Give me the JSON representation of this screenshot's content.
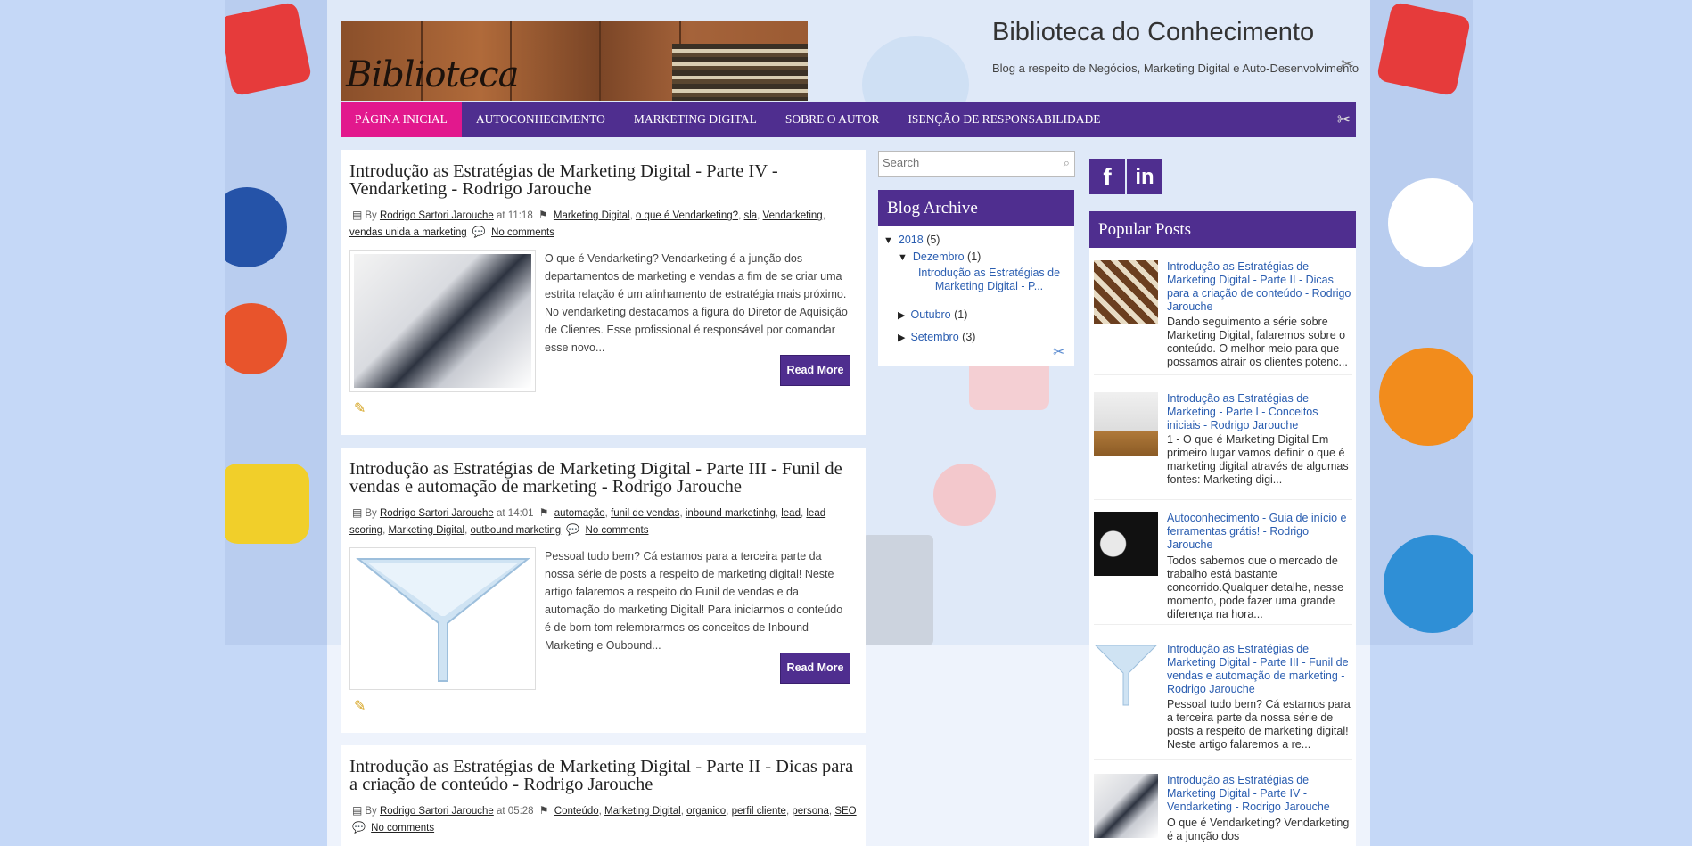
{
  "header": {
    "banner_word": "Biblioteca",
    "title": "Biblioteca do Conhecimento",
    "description": "Blog a respeito de Negócios, Marketing Digital e Auto-Desenvolvimento"
  },
  "nav": {
    "items": [
      {
        "label": "Página Inicial"
      },
      {
        "label": "Autoconhecimento"
      },
      {
        "label": "Marketing Digital"
      },
      {
        "label": "Sobre o Autor"
      },
      {
        "label": "Isenção de Responsabilidade"
      }
    ]
  },
  "posts": [
    {
      "title": "Introdução as Estratégias de Marketing Digital - Parte IV - Vendarketing - Rodrigo Jarouche",
      "by": "By",
      "author": "Rodrigo Sartori Jarouche",
      "at": "at 11:18",
      "labels": [
        "Marketing Digital",
        "o que é Vendarketing?",
        "sla",
        "Vendarketing",
        "vendas unida a marketing"
      ],
      "comments": "No comments",
      "excerpt": "O que é Vendarketing? Vendarketing é a junção dos departamentos de marketing e vendas a fim de se criar uma estrita relação é um alinhamento de estratégia mais próximo. No vendarketing destacamos a figura do Diretor de Aquisição de Clientes. Esse profissional é responsável por comandar esse novo...",
      "read_more": "Read More"
    },
    {
      "title": "Introdução as Estratégias de Marketing Digital - Parte III - Funil de vendas e automação de marketing - Rodrigo Jarouche",
      "by": "By",
      "author": "Rodrigo Sartori Jarouche",
      "at": "at 14:01",
      "labels": [
        "automação",
        "funil de vendas",
        "inbound marketinhg",
        "lead",
        "lead scoring",
        "Marketing Digital",
        "outbound marketing"
      ],
      "comments": "No comments",
      "excerpt": "Pessoal tudo bem? Cá estamos para a terceira parte da nossa série de posts a respeito de marketing digital! Neste artigo falaremos a respeito do Funil de vendas e da automação do marketing Digital! Para iniciarmos o conteúdo é de bom tom relembrarmos os conceitos de Inbound Marketing e Oubound...",
      "read_more": "Read More"
    },
    {
      "title": "Introdução as Estratégias de Marketing Digital - Parte II - Dicas para a criação de conteúdo - Rodrigo Jarouche",
      "by": "By",
      "author": "Rodrigo Sartori Jarouche",
      "at": "at 05:28",
      "labels": [
        "Conteúdo",
        "Marketing Digital",
        "organico",
        "perfil cliente",
        "persona",
        "SEO"
      ],
      "comments": "No comments"
    }
  ],
  "search": {
    "placeholder": "Search"
  },
  "archive": {
    "heading": "Blog Archive",
    "year": "2018",
    "year_count": "(5)",
    "months": [
      {
        "name": "Dezembro",
        "count": "(1)"
      },
      {
        "name": "Outubro",
        "count": "(1)"
      },
      {
        "name": "Setembro",
        "count": "(3)"
      }
    ],
    "open_post": "Introdução as Estratégias de Marketing Digital - P..."
  },
  "social": {
    "facebook": "f",
    "linkedin": "in"
  },
  "popular": {
    "heading": "Popular Posts",
    "items": [
      {
        "title": "Introdução as Estratégias de Marketing Digital - Parte II - Dicas para a criação de conteúdo - Rodrigo Jarouche",
        "snippet": "Dando seguimento a série sobre Marketing Digital, falaremos sobre o conteúdo. O melhor meio para que possamos atrair os clientes potenc..."
      },
      {
        "title": "Introdução as Estratégias de Marketing - Parte I - Conceitos iniciais - Rodrigo Jarouche",
        "snippet": "1 - O que é Marketing Digital Em primeiro lugar vamos definir o que é marketing digital através de algumas fontes: Marketing digi..."
      },
      {
        "title": "Autoconhecimento - Guia de início e ferramentas grátis! - Rodrigo Jarouche",
        "snippet": "Todos sabemos que o mercado de trabalho está bastante concorrido.Qualquer detalhe, nesse momento, pode fazer uma grande diferença na hora..."
      },
      {
        "title": "Introdução as Estratégias de Marketing Digital - Parte III - Funil de vendas e automação de marketing - Rodrigo Jarouche",
        "snippet": "Pessoal tudo bem? Cá estamos para a terceira parte da nossa série de posts a respeito de marketing digital! Neste artigo falaremos a re..."
      },
      {
        "title": "Introdução as Estratégias de Marketing Digital - Parte IV - Vendarketing - Rodrigo Jarouche",
        "snippet": "O que é Vendarketing? Vendarketing é a junção dos"
      }
    ]
  },
  "colors": {
    "accent": "#4f2e8f",
    "nav_active": "#e2188d",
    "link": "#2a5db0"
  }
}
